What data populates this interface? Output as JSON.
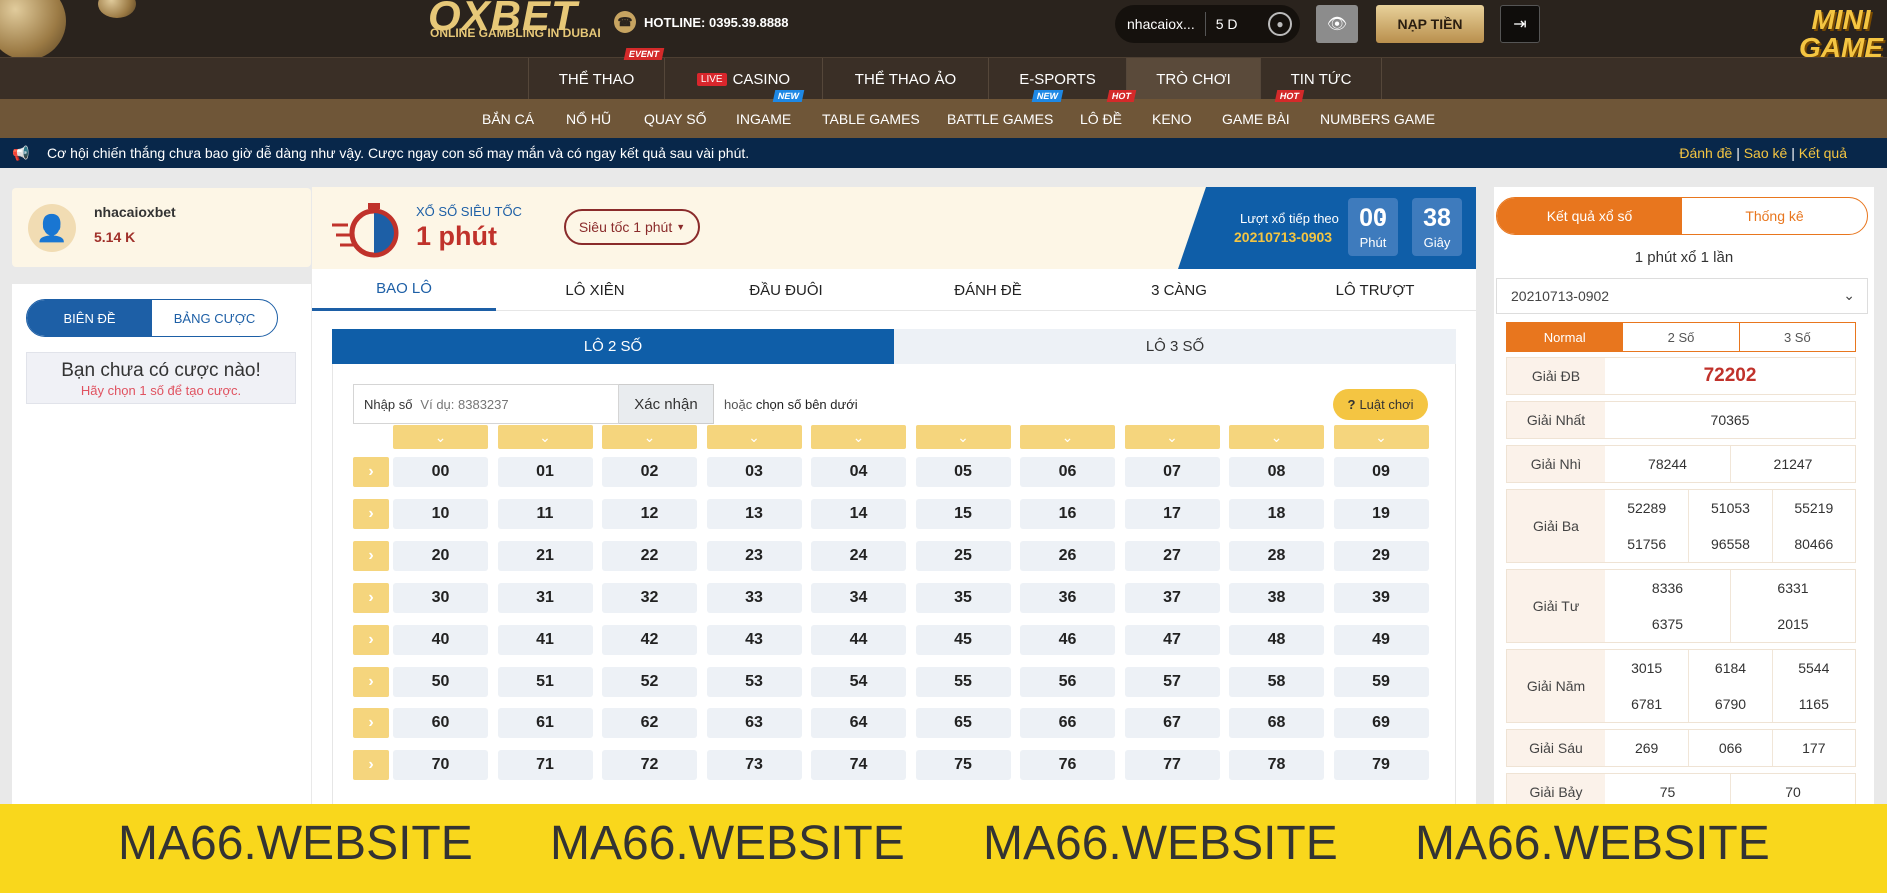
{
  "header": {
    "logo": "OXBET",
    "logo_tagline": "ONLINE GAMBLING IN DUBAI",
    "hotline": "HOTLINE: 0395.39.8888",
    "username": "nhacaiox...",
    "days": "5 D",
    "deposit_label": "NẠP TIỀN",
    "mini_game_logo": "MINI GAME"
  },
  "nav": [
    {
      "label": "THỂ THAO",
      "badge": "EVENT"
    },
    {
      "label": "CASINO",
      "live": "LIVE"
    },
    {
      "label": "THỂ THAO ẢO"
    },
    {
      "label": "E-SPORTS"
    },
    {
      "label": "TRÒ CHƠI"
    },
    {
      "label": "TIN TỨC"
    }
  ],
  "subnav": [
    {
      "label": "BẮN CÁ"
    },
    {
      "label": "NỔ HŨ"
    },
    {
      "label": "QUAY SỐ"
    },
    {
      "label": "INGAME",
      "badge": "NEW"
    },
    {
      "label": "TABLE GAMES"
    },
    {
      "label": "BATTLE GAMES",
      "badge": "NEW"
    },
    {
      "label": "LÔ ĐỀ",
      "badge": "HOT"
    },
    {
      "label": "KENO"
    },
    {
      "label": "GAME BÀI",
      "badge": "HOT"
    },
    {
      "label": "NUMBERS GAME"
    }
  ],
  "ticker": {
    "message": "Cơ hội chiến thắng chưa bao giờ dễ dàng như vậy. Cược ngay con số may mắn và có ngay kết quả sau vài phút.",
    "link1": "Đánh đề",
    "link2": "Sao kê",
    "link3": "Kết quả"
  },
  "user": {
    "name": "nhacaioxbet",
    "balance": "5.14 K"
  },
  "betslip": {
    "tab1": "BIÊN ĐỀ",
    "tab2": "BẢNG CƯỢC",
    "empty_title": "Bạn chưa có cược nào!",
    "empty_hint": "Hãy chọn 1 số để tạo cược."
  },
  "game": {
    "subtitle": "XỔ SỐ SIÊU TỐC",
    "title": "1 phút",
    "dropdown": "Siêu tốc 1 phút",
    "next_label": "Lượt xổ tiếp theo",
    "next_id": "20210713-0903",
    "minutes": "00",
    "minutes_unit": "Phút",
    "seconds": "38",
    "seconds_unit": "Giây",
    "colon": ":"
  },
  "tabs": [
    "BAO LÔ",
    "LÔ XIÊN",
    "ĐẦU ĐUÔI",
    "ĐÁNH ĐỀ",
    "3 CÀNG",
    "LÔ TRƯỢT"
  ],
  "subtabs": [
    "LÔ 2 SỐ",
    "LÔ 3 SỐ"
  ],
  "input": {
    "label": "Nhập số",
    "placeholder": "Ví dụ: 8383237",
    "confirm": "Xác nhận",
    "or_text": "hoặc",
    "or_link": "chọn số bên dưới",
    "rules": "Luật chơi"
  },
  "numbers": [
    [
      "00",
      "01",
      "02",
      "03",
      "04",
      "05",
      "06",
      "07",
      "08",
      "09"
    ],
    [
      "10",
      "11",
      "12",
      "13",
      "14",
      "15",
      "16",
      "17",
      "18",
      "19"
    ],
    [
      "20",
      "21",
      "22",
      "23",
      "24",
      "25",
      "26",
      "27",
      "28",
      "29"
    ],
    [
      "30",
      "31",
      "32",
      "33",
      "34",
      "35",
      "36",
      "37",
      "38",
      "39"
    ],
    [
      "40",
      "41",
      "42",
      "43",
      "44",
      "45",
      "46",
      "47",
      "48",
      "49"
    ],
    [
      "50",
      "51",
      "52",
      "53",
      "54",
      "55",
      "56",
      "57",
      "58",
      "59"
    ],
    [
      "60",
      "61",
      "62",
      "63",
      "64",
      "65",
      "66",
      "67",
      "68",
      "69"
    ],
    [
      "70",
      "71",
      "72",
      "73",
      "74",
      "75",
      "76",
      "77",
      "78",
      "79"
    ]
  ],
  "results": {
    "tab1": "Kết quả xổ số",
    "tab2": "Thống kê",
    "subtitle": "1 phút xổ 1 lần",
    "draw": "20210713-0902",
    "modes": [
      "Normal",
      "2 Số",
      "3 Số"
    ],
    "prizes": [
      {
        "name": "Giải ĐB",
        "values": [
          "72202"
        ]
      },
      {
        "name": "Giải Nhất",
        "values": [
          "70365"
        ]
      },
      {
        "name": "Giải Nhì",
        "values": [
          "78244",
          "21247"
        ]
      },
      {
        "name": "Giải Ba",
        "values": [
          "52289",
          "51053",
          "55219",
          "51756",
          "96558",
          "80466"
        ]
      },
      {
        "name": "Giải Tư",
        "values": [
          "8336",
          "6331",
          "6375",
          "2015"
        ]
      },
      {
        "name": "Giải Năm",
        "values": [
          "3015",
          "6184",
          "5544",
          "6781",
          "6790",
          "1165"
        ]
      },
      {
        "name": "Giải Sáu",
        "values": [
          "269",
          "066",
          "177"
        ]
      },
      {
        "name": "Giải Bảy",
        "values": [
          "75",
          "70"
        ]
      }
    ]
  },
  "footer": [
    "MA66.WEBSITE",
    "MA66.WEBSITE",
    "MA66.WEBSITE",
    "MA66.WEBSITE"
  ],
  "colors": {
    "primary_blue": "#0f5ea8",
    "accent_gold": "#f5d57d",
    "orange": "#e8761e",
    "red": "#c0322b"
  }
}
